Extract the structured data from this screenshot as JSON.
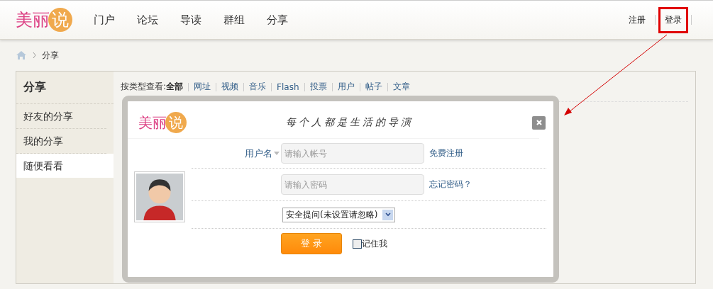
{
  "header": {
    "logo": {
      "text": "美丽",
      "badge": "说"
    },
    "nav": [
      {
        "label": "门户",
        "selected": false
      },
      {
        "label": "论坛",
        "selected": false
      },
      {
        "label": "导读",
        "selected": false
      },
      {
        "label": "群组",
        "selected": false
      },
      {
        "label": "分享",
        "selected": false
      }
    ],
    "account_links": [
      {
        "label": "注册",
        "highlighted": false
      },
      {
        "label": "登录",
        "highlighted": true
      }
    ]
  },
  "breadcrumb": {
    "current": "分享"
  },
  "sidebar": {
    "title": "分享",
    "items": [
      {
        "label": "好友的分享",
        "selected": false
      },
      {
        "label": "我的分享",
        "selected": false
      },
      {
        "label": "随便看看",
        "selected": true
      }
    ]
  },
  "filter": {
    "label": "按类型查看:",
    "options": [
      {
        "label": "全部",
        "selected": true
      },
      {
        "label": "网址",
        "selected": false
      },
      {
        "label": "视频",
        "selected": false
      },
      {
        "label": "音乐",
        "selected": false
      },
      {
        "label": "Flash",
        "selected": false
      },
      {
        "label": "投票",
        "selected": false
      },
      {
        "label": "用户",
        "selected": false
      },
      {
        "label": "帖子",
        "selected": false
      },
      {
        "label": "文章",
        "selected": false
      }
    ]
  },
  "login_dialog": {
    "logo": {
      "text": "美丽",
      "badge": "说"
    },
    "slogan": "每个人都是生活的导演",
    "username": {
      "label": "用户名",
      "placeholder": "请输入帐号",
      "link": "免费注册"
    },
    "password": {
      "placeholder": "请输入密码",
      "link": "忘记密码？"
    },
    "security_question": {
      "value": "安全提问(未设置请忽略)"
    },
    "submit": "登 录",
    "remember": {
      "label": "记住我",
      "checked": false
    }
  },
  "annotation_arrow": true
}
